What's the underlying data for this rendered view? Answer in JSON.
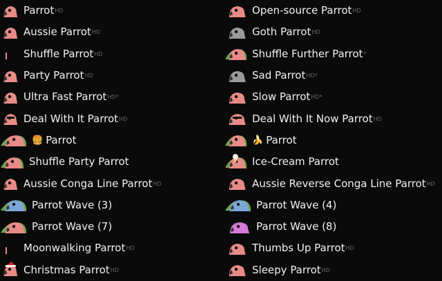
{
  "left": [
    {
      "name": "Parrot",
      "tag": "HD",
      "icon": "parrot-icon",
      "w": 28
    },
    {
      "name": "Aussie Parrot",
      "tag": "HD",
      "icon": "aussie-parrot-icon",
      "w": 28
    },
    {
      "name": "Shuffle Parrot",
      "tag": "HD",
      "icon": "shuffle-parrot-icon",
      "w": 28
    },
    {
      "name": "Party Parrot",
      "tag": "HD",
      "icon": "party-parrot-icon",
      "w": 28
    },
    {
      "name": "Ultra Fast Parrot",
      "tag": "HD*",
      "icon": "ultra-fast-parrot-icon",
      "w": 28
    },
    {
      "name": "Deal With It Parrot",
      "tag": "HD",
      "icon": "deal-with-it-parrot-icon",
      "w": 28
    },
    {
      "name": "Parrot",
      "prefix": "🍔",
      "tag": "",
      "icon": "burger-parrot-icon",
      "w": 40
    },
    {
      "name": "Shuffle Party Parrot",
      "tag": "",
      "icon": "shuffle-party-parrot-icon",
      "w": 36
    },
    {
      "name": "Aussie Conga Line Parrot",
      "tag": "HD",
      "icon": "aussie-conga-line-parrot-icon",
      "w": 28
    },
    {
      "name": "Parrot Wave (3)",
      "tag": "",
      "icon": "parrot-wave-3-icon",
      "w": 40
    },
    {
      "name": "Parrot Wave (7)",
      "tag": "",
      "icon": "parrot-wave-7-icon",
      "w": 40
    },
    {
      "name": "Moonwalking Parrot",
      "tag": "HD",
      "icon": "moonwalking-parrot-icon",
      "w": 28
    },
    {
      "name": "Christmas Parrot",
      "tag": "HD",
      "icon": "christmas-parrot-icon",
      "w": 28
    }
  ],
  "right": [
    {
      "name": "Open-source Parrot",
      "tag": "HD",
      "icon": "open-source-parrot-icon",
      "w": 34
    },
    {
      "name": "Goth Parrot",
      "tag": "HD",
      "icon": "goth-parrot-icon",
      "w": 34
    },
    {
      "name": "Shuffle Further Parrot",
      "tag": "*",
      "icon": "shuffle-further-parrot-icon",
      "w": 34
    },
    {
      "name": "Sad Parrot",
      "tag": "HD*",
      "icon": "sad-parrot-icon",
      "w": 34
    },
    {
      "name": "Slow Parrot",
      "tag": "HD*",
      "icon": "slow-parrot-icon",
      "w": 34
    },
    {
      "name": "Deal With It Now Parrot",
      "tag": "HD",
      "icon": "deal-with-it-now-parrot-icon",
      "w": 34
    },
    {
      "name": "Parrot",
      "prefix": "🍌",
      "tag": "",
      "icon": "banana-parrot-icon",
      "w": 34
    },
    {
      "name": "Ice-Cream Parrot",
      "tag": "",
      "icon": "ice-cream-parrot-icon",
      "w": 34
    },
    {
      "name": "Aussie Reverse Conga Line Parrot",
      "tag": "HD",
      "icon": "aussie-reverse-conga-line-parrot-icon",
      "w": 34
    },
    {
      "name": "Parrot Wave (4)",
      "tag": "",
      "icon": "parrot-wave-4-icon",
      "w": 40
    },
    {
      "name": "Parrot Wave (8)",
      "tag": "",
      "icon": "parrot-wave-8-icon",
      "w": 40
    },
    {
      "name": "Thumbs Up Parrot",
      "tag": "HD",
      "icon": "thumbs-up-parrot-icon",
      "w": 34
    },
    {
      "name": "Sleepy Parrot",
      "tag": "HD",
      "icon": "sleepy-parrot-icon",
      "w": 34
    }
  ],
  "colors": {
    "background": "#0a0a0a",
    "text": "#f2f2f2",
    "superscript": "#6a6a6a",
    "parrot_pink": "#e88b87",
    "parrot_green": "#6fa64a",
    "parrot_blue": "#7aa7d8",
    "parrot_magenta": "#d57ad8",
    "goth_grey": "#9a9a9a"
  }
}
